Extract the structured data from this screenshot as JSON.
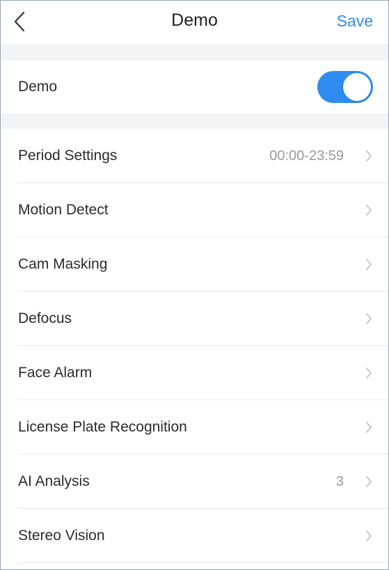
{
  "header": {
    "title": "Demo",
    "save_label": "Save",
    "back_icon": "chevron-left-icon"
  },
  "toggle": {
    "label": "Demo",
    "on": true
  },
  "list": {
    "items": [
      {
        "label": "Period Settings",
        "value": "00:00-23:59"
      },
      {
        "label": "Motion Detect",
        "value": ""
      },
      {
        "label": "Cam Masking",
        "value": ""
      },
      {
        "label": "Defocus",
        "value": ""
      },
      {
        "label": "Face Alarm",
        "value": ""
      },
      {
        "label": "License Plate Recognition",
        "value": ""
      },
      {
        "label": "AI Analysis",
        "value": "3"
      },
      {
        "label": "Stereo Vision",
        "value": ""
      }
    ]
  },
  "colors": {
    "accent": "#2f8cf0",
    "section_gap": "#f4f4f4",
    "divider": "#e9e9e9",
    "value_text": "#9a9a9a"
  }
}
